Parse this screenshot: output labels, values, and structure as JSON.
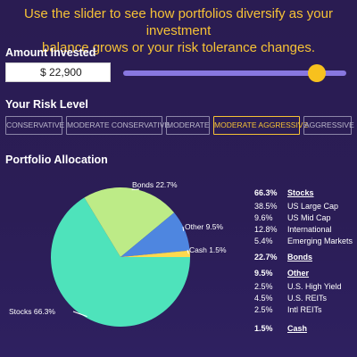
{
  "headline": {
    "line1": "Use the slider to see how portfolios diversify as your investment",
    "line2": "balance grows or your risk tolerance changes."
  },
  "amount": {
    "label": "Amount Invested",
    "value": "$ 22,900",
    "slider_level": 0.9
  },
  "risk": {
    "label": "Your Risk Level",
    "levels": [
      "CONSERVATIVE",
      "MODERATE CONSERVATIVE",
      "MODERATE",
      "MODERATE AGGRESSIVE",
      "AGGRESSIVE"
    ],
    "selected": "MODERATE AGGRESSIVE"
  },
  "allocation": {
    "label": "Portfolio Allocation",
    "legend": [
      {
        "pct": "66.3%",
        "name": "Stocks",
        "head": true
      },
      {
        "pct": "38.5%",
        "name": "US Large Cap"
      },
      {
        "pct": "9.6%",
        "name": "US Mid Cap"
      },
      {
        "pct": "12.8%",
        "name": "International"
      },
      {
        "pct": "5.4%",
        "name": "Emerging Markets"
      },
      {
        "pct": "22.7%",
        "name": "Bonds",
        "head": true
      },
      {
        "pct": "9.5%",
        "name": "Other",
        "head": true
      },
      {
        "pct": "2.5%",
        "name": "U.S. High Yield"
      },
      {
        "pct": "4.5%",
        "name": "U.S. REITs"
      },
      {
        "pct": "2.5%",
        "name": "Intl REITs"
      },
      {
        "pct": "1.5%",
        "name": "Cash",
        "head": true
      }
    ]
  },
  "colors": {
    "accent": "#f6c236",
    "slider_track": "#8877e0",
    "stocks": "#4ee3bb",
    "bonds": "#bdeb87",
    "other": "#4e86e0",
    "cash": "#fdd94e"
  },
  "chart_data": {
    "type": "pie",
    "categories": [
      "Stocks",
      "Bonds",
      "Other",
      "Cash"
    ],
    "values": [
      66.3,
      22.7,
      9.5,
      1.5
    ],
    "labels": [
      "Stocks 66.3%",
      "Bonds 22.7%",
      "Other 9.5%",
      "Cash 1.5%"
    ],
    "colors": [
      "#4ee3bb",
      "#bdeb87",
      "#4e86e0",
      "#fdd94e"
    ]
  }
}
